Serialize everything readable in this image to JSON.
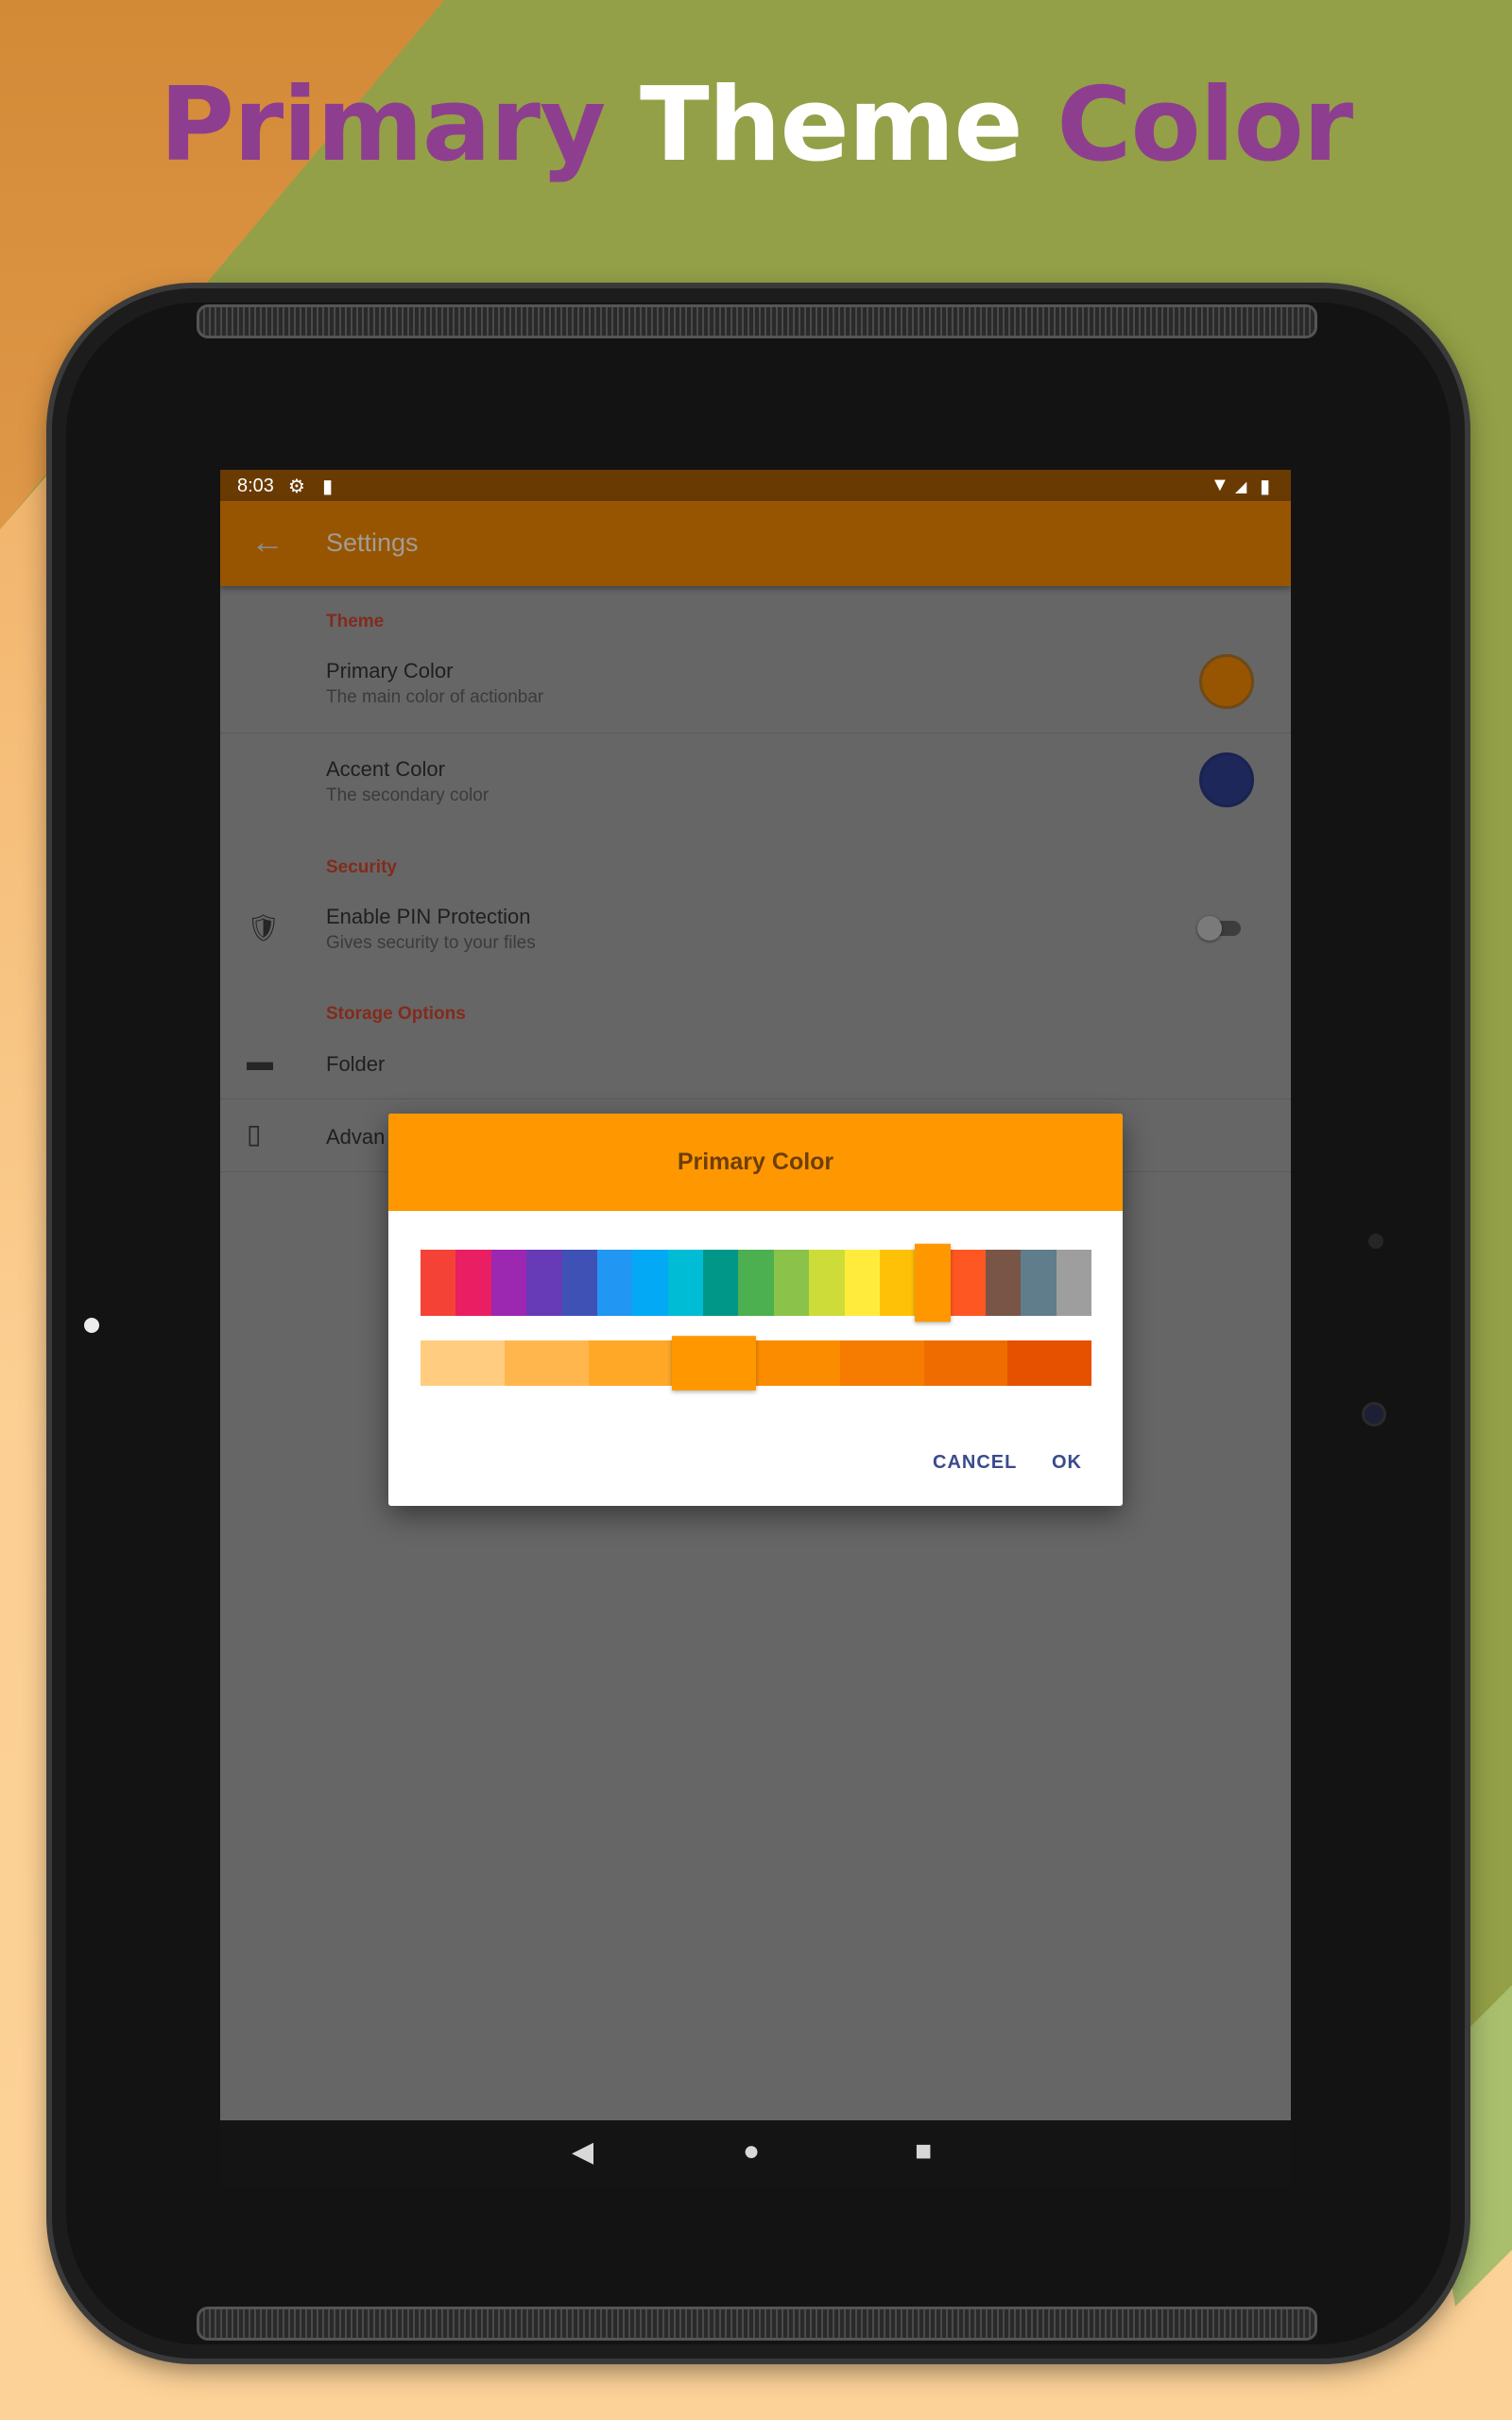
{
  "headline": {
    "primary": "Primary",
    "theme": "Theme",
    "color": "Color"
  },
  "status": {
    "time": "8:03",
    "icons": [
      "gear-icon",
      "sdcard-icon",
      "wifi-icon",
      "signal-icon",
      "battery-icon"
    ]
  },
  "appbar": {
    "title": "Settings",
    "back_icon": "arrow-back-icon"
  },
  "settings": {
    "theme_header": "Theme",
    "primary_title": "Primary Color",
    "primary_sub": "The main color of actionbar",
    "primary_swatch": "#975502",
    "accent_title": "Accent Color",
    "accent_sub": "The secondary color",
    "accent_swatch": "#1e2759",
    "security_header": "Security",
    "pin_title": "Enable PIN Protection",
    "pin_sub": "Gives security to your files",
    "pin_enabled": false,
    "storage_header": "Storage Options",
    "folder_title": "Folder",
    "advanced_title": "Advan"
  },
  "dialog": {
    "title": "Primary Color",
    "cancel": "CANCEL",
    "ok": "OK",
    "palette": [
      "#f44336",
      "#e91e63",
      "#9c27b0",
      "#673ab7",
      "#3f51b5",
      "#2196f3",
      "#03a9f4",
      "#00bcd4",
      "#009688",
      "#4caf50",
      "#8bc34a",
      "#cddc39",
      "#ffeb3b",
      "#ffc107",
      "#ff9800",
      "#ff5722",
      "#795548",
      "#607d8b",
      "#9e9e9e"
    ],
    "palette_selected": 14,
    "shades": [
      "#ffcc80",
      "#ffb74d",
      "#ffa726",
      "#ff9800",
      "#fb8c00",
      "#f57c00",
      "#ef6c00",
      "#e65100"
    ],
    "shades_selected": 3
  },
  "colors": {
    "statusbar": "#693b03",
    "appbar": "#975502",
    "dialog_header": "#ff9800",
    "button_text": "#3a4b8c"
  }
}
